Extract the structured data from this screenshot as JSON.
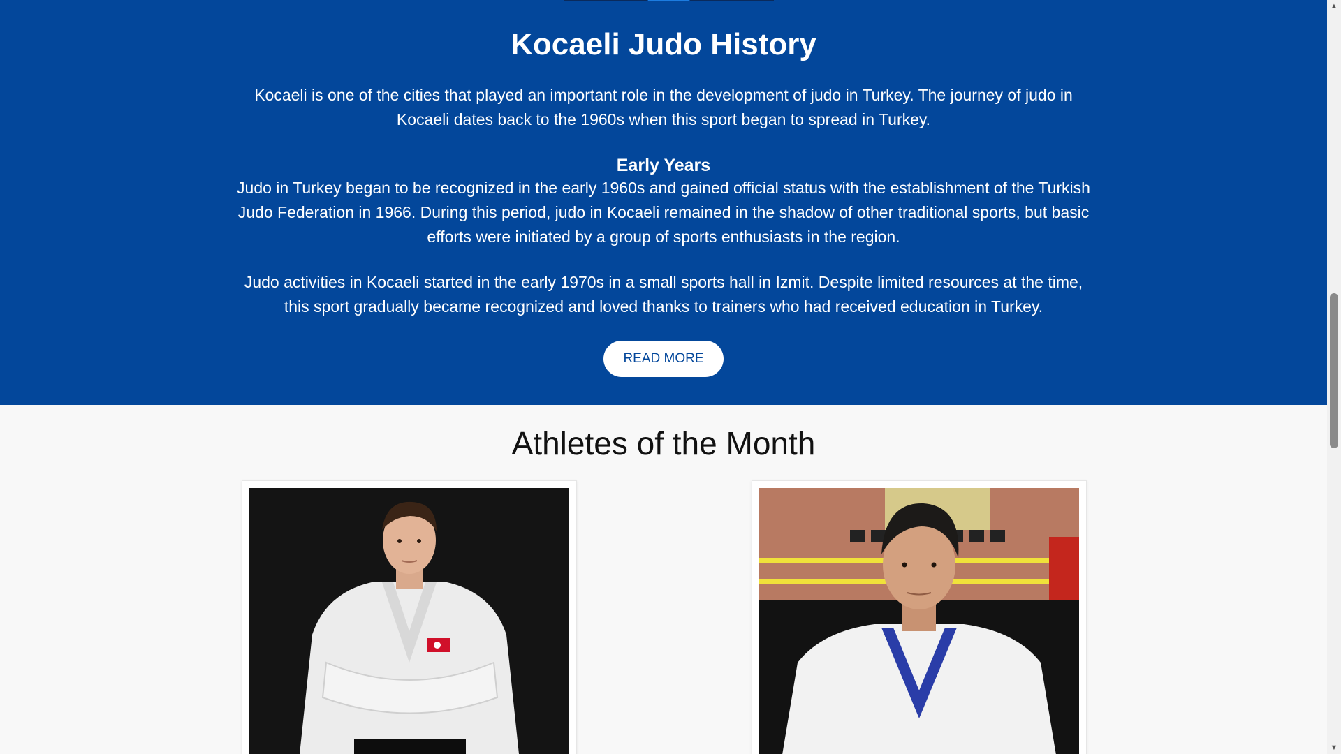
{
  "history": {
    "title": "Kocaeli Judo History",
    "intro": "Kocaeli is one of the cities that played an important role in the development of judo in Turkey. The journey of judo in Kocaeli dates back to the 1960s when this sport began to spread in Turkey.",
    "early_years_title": "Early Years",
    "early_years_text": "Judo in Turkey began to be recognized in the early 1960s and gained official status with the establishment of the Turkish Judo Federation in 1966. During this period, judo in Kocaeli remained in the shadow of other traditional sports, but basic efforts were initiated by a group of sports enthusiasts in the region.",
    "activities_text": "Judo activities in Kocaeli started in the early 1970s in a small sports hall in Izmit. Despite limited resources at the time, this sport gradually became recognized and loved thanks to trainers who had received education in Turkey.",
    "read_more_label": "READ MORE"
  },
  "athletes": {
    "title": "Athletes of the Month",
    "cards": [
      {
        "photo": "athlete-photo"
      },
      {
        "photo": "athlete-photo"
      }
    ]
  },
  "colors": {
    "primary_blue": "#03479b",
    "page_background": "#f8f8f8",
    "button_background": "#ffffff"
  },
  "icons": {
    "scroll_up": "scroll-up-arrow-icon",
    "scroll_down": "scroll-down-arrow-icon"
  }
}
